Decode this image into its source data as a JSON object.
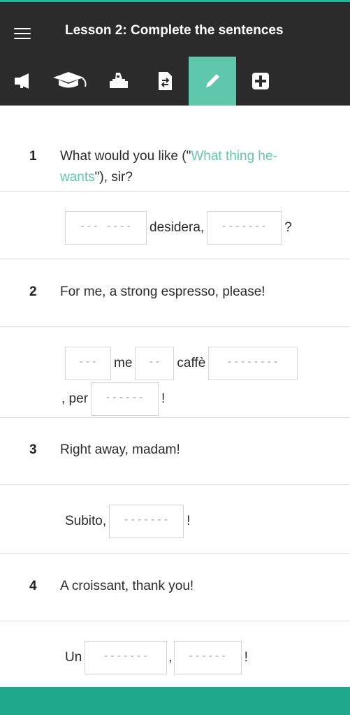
{
  "header": {
    "title": "Lesson 2: Complete the sentences",
    "menu_icon": "hamburger-menu-icon"
  },
  "toolbar": {
    "tabs": [
      {
        "icon": "megaphone-icon",
        "active": false
      },
      {
        "icon": "graduation-cap-icon",
        "active": false
      },
      {
        "icon": "hand-box-icon",
        "active": false
      },
      {
        "icon": "document-swap-icon",
        "active": false
      },
      {
        "icon": "pencil-icon",
        "active": true
      },
      {
        "icon": "plus-icon",
        "active": false
      }
    ],
    "active_color": "#5fc8ac"
  },
  "exercises": [
    {
      "number": "1",
      "prompt_before": "What would you like (\"",
      "prompt_hint": "What thing he-wants",
      "prompt_after": "\"), sir?",
      "answer": {
        "blank1": "--- ----",
        "word1": "desidera,",
        "blank2": "-------",
        "word2": "?"
      }
    },
    {
      "number": "2",
      "prompt": "For me, a strong espresso, please!",
      "answer": {
        "blank1": "---",
        "word1": "me",
        "blank2": "--",
        "word2": "caffè",
        "blank3": "--------",
        "word3": ", per",
        "blank4": "------",
        "word4": "!"
      }
    },
    {
      "number": "3",
      "prompt": "Right away, madam!",
      "answer": {
        "word1": "Subito,",
        "blank1": "-------",
        "word2": "!"
      }
    },
    {
      "number": "4",
      "prompt": "A croissant, thank you!",
      "answer": {
        "word1": "Un",
        "blank1": "-------",
        "word2": ",",
        "blank2": "------",
        "word3": "!"
      }
    }
  ],
  "colors": {
    "header_bg": "#2b2b2b",
    "accent": "#1fb89a",
    "hint_text": "#5fc8ac",
    "bottom_bar": "#1fa88b"
  }
}
